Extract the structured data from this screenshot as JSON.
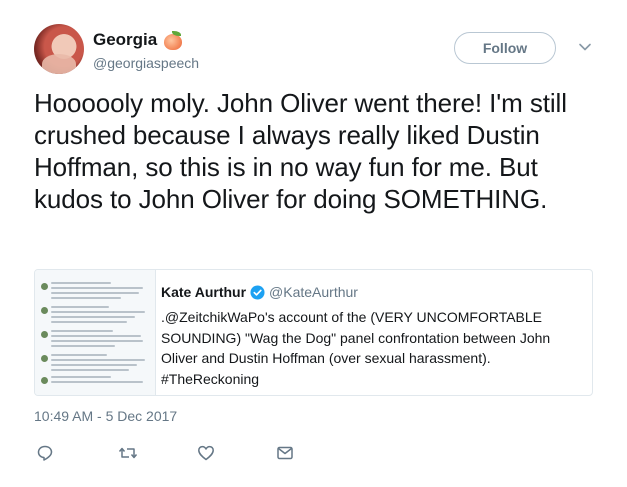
{
  "author": {
    "display_name": "Georgia",
    "handle": "@georgiaspeech",
    "name_emoji": "peach-emoji"
  },
  "follow_label": "Follow",
  "tweet": {
    "text": "Hoooooly moly. John Oliver went there! I'm still crushed because I always really liked Dustin Hoffman, so this is in no way fun for me. But kudos to John Oliver for doing SOMETHING.",
    "timestamp": "10:49 AM - 5 Dec 2017"
  },
  "quoted_tweet": {
    "name": "Kate Aurthur",
    "handle": "@KateAurthur",
    "verified": true,
    "text": ".@ZeitchikWaPo's account of the (VERY UNCOMFORTABLE SOUNDING) \"Wag the Dog\" panel confrontation between John Oliver and Dustin Hoffman (over sexual harassment). #TheReckoning"
  },
  "actions": [
    "reply-icon",
    "retweet-icon",
    "like-icon",
    "direct-message-icon"
  ],
  "colors": {
    "text": "#14171a",
    "secondary": "#657786",
    "border": "#e1e8ed",
    "verified": "#1da1f2"
  }
}
